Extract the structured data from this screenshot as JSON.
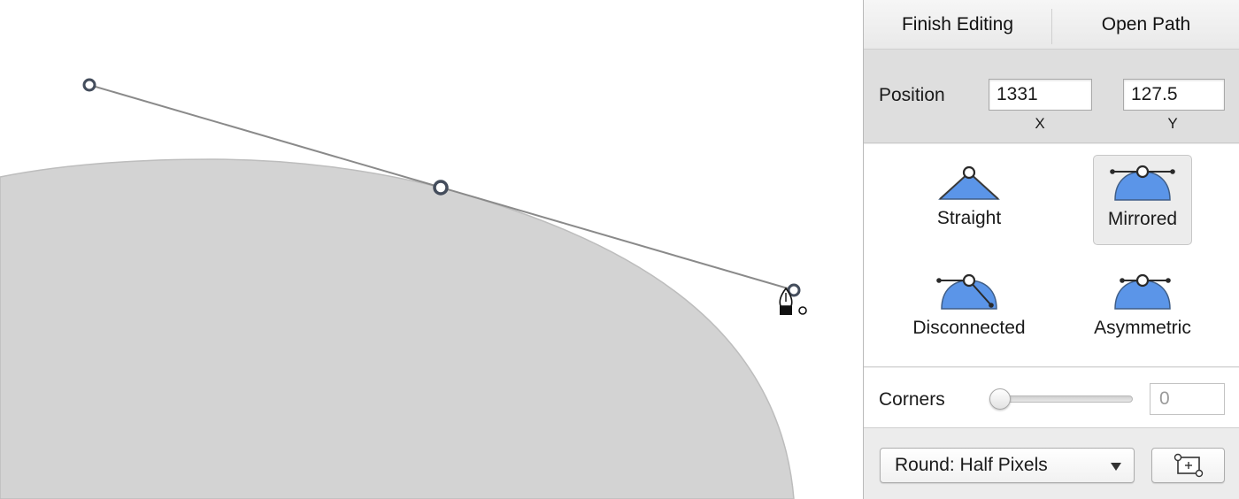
{
  "toolbar": {
    "finish_editing": "Finish Editing",
    "open_path": "Open Path"
  },
  "position": {
    "label": "Position",
    "x_value": "1331",
    "y_value": "127.5",
    "x_label": "X",
    "y_label": "Y"
  },
  "point_modes": {
    "selected": "Mirrored",
    "items": [
      {
        "label": "Straight",
        "icon": "straight-point-icon"
      },
      {
        "label": "Mirrored",
        "icon": "mirrored-point-icon"
      },
      {
        "label": "Disconnected",
        "icon": "disconnected-point-icon"
      },
      {
        "label": "Asymmetric",
        "icon": "asymmetric-point-icon"
      }
    ]
  },
  "corners": {
    "label": "Corners",
    "value": "0",
    "slider_level": 0
  },
  "rounding": {
    "selected": "Round: Half Pixels",
    "icon": "chevron-down-icon"
  },
  "frame_button": {
    "icon": "fit-frame-icon"
  },
  "colors": {
    "shape_fill": "#d3d3d3",
    "mode_icon_fill": "#5b95e8",
    "handle_stroke": "#444d5c",
    "panel_bg": "#ececec",
    "position_bg": "#dedede"
  }
}
